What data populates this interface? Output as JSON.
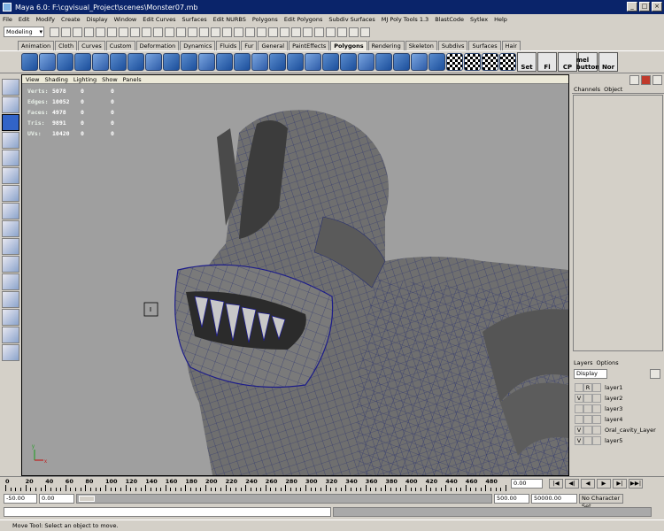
{
  "window": {
    "title": "Maya 6.0: F:\\cgvisual_Project\\scenes\\Monster07.mb",
    "buttons": [
      "_",
      "□",
      "×"
    ]
  },
  "menus": [
    "File",
    "Edit",
    "Modify",
    "Create",
    "Display",
    "Window",
    "Edit Curves",
    "Surfaces",
    "Edit NURBS",
    "Polygons",
    "Edit Polygons",
    "Subdiv Surfaces",
    "MJ Poly Tools 1.3",
    "BlastCode",
    "Sytlex",
    "Help"
  ],
  "status": {
    "mode": "Modeling"
  },
  "shelf_tabs": [
    "Animation",
    "Cloth",
    "Curves",
    "Custom",
    "Deformation",
    "Dynamics",
    "Fluids",
    "Fur",
    "General",
    "PaintEffects",
    "Polygons",
    "Rendering",
    "Skeleton",
    "Subdivs",
    "Surfaces",
    "Hair"
  ],
  "shelf_active": "Polygons",
  "shelf_labels": [
    "Set",
    "Fl",
    "CP",
    "mel button",
    "Nor"
  ],
  "viewport": {
    "menu": [
      "View",
      "Shading",
      "Lighting",
      "Show",
      "Panels"
    ],
    "hud": [
      {
        "label": "Verts:",
        "a": "5078",
        "b": "0",
        "c": "0"
      },
      {
        "label": "Edges:",
        "a": "10052",
        "b": "0",
        "c": "0"
      },
      {
        "label": "Faces:",
        "a": "4978",
        "b": "0",
        "c": "0"
      },
      {
        "label": "Tris:",
        "a": "9891",
        "b": "0",
        "c": "0"
      },
      {
        "label": "UVs:",
        "a": "10420",
        "b": "0",
        "c": "0"
      }
    ]
  },
  "channelbox": {
    "tabs": [
      "Channels",
      "Object"
    ]
  },
  "layers": {
    "tabs": [
      "Layers",
      "Options"
    ],
    "display": "Display",
    "rows": [
      {
        "v": "",
        "r": "R",
        "name": "layer1"
      },
      {
        "v": "V",
        "r": "",
        "name": "layer2"
      },
      {
        "v": "",
        "r": "",
        "name": "layer3"
      },
      {
        "v": "",
        "r": "",
        "name": "layer4"
      },
      {
        "v": "V",
        "r": "",
        "name": "Oral_cavity_Layer"
      },
      {
        "v": "V",
        "r": "",
        "name": "layer5"
      }
    ]
  },
  "timeline": {
    "ticks": [
      "0",
      "20",
      "40",
      "60",
      "80",
      "100",
      "120",
      "140",
      "160",
      "180",
      "200",
      "220",
      "240",
      "260",
      "280",
      "300",
      "320",
      "340",
      "360",
      "380",
      "400",
      "420",
      "440",
      "460",
      "480"
    ],
    "current": "0.00"
  },
  "range": {
    "start": "-50.00",
    "inner_start": "0.00",
    "inner_end": "500.00",
    "end": "50000.00",
    "character": "No Character Set"
  },
  "help": "Move Tool: Select an object to move."
}
